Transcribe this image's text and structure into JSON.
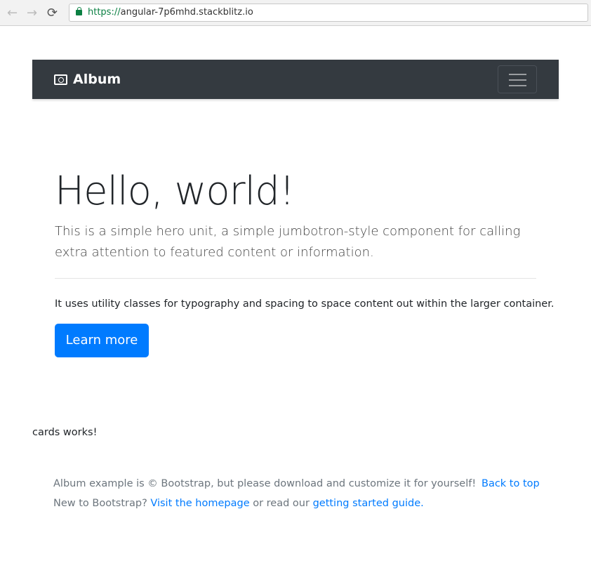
{
  "browser": {
    "url_scheme": "https://",
    "url_host": "angular-7p6mhd.stackblitz.io"
  },
  "navbar": {
    "brand": "Album"
  },
  "hero": {
    "title": "Hello, world!",
    "lead": "This is a simple hero unit, a simple jumbotron-style component for calling extra attention to featured content or information.",
    "text": "It uses utility classes for typography and spacing to space content out within the larger container.",
    "button": "Learn more"
  },
  "cards_text": "cards works!",
  "footer": {
    "copyright": "Album example is © Bootstrap, but please download and customize it for yourself!",
    "back_to_top": "Back to top",
    "new_prefix": "New to Bootstrap?",
    "homepage_link": "Visit the homepage",
    "middle": "or read our",
    "guide_link": "getting started guide."
  }
}
